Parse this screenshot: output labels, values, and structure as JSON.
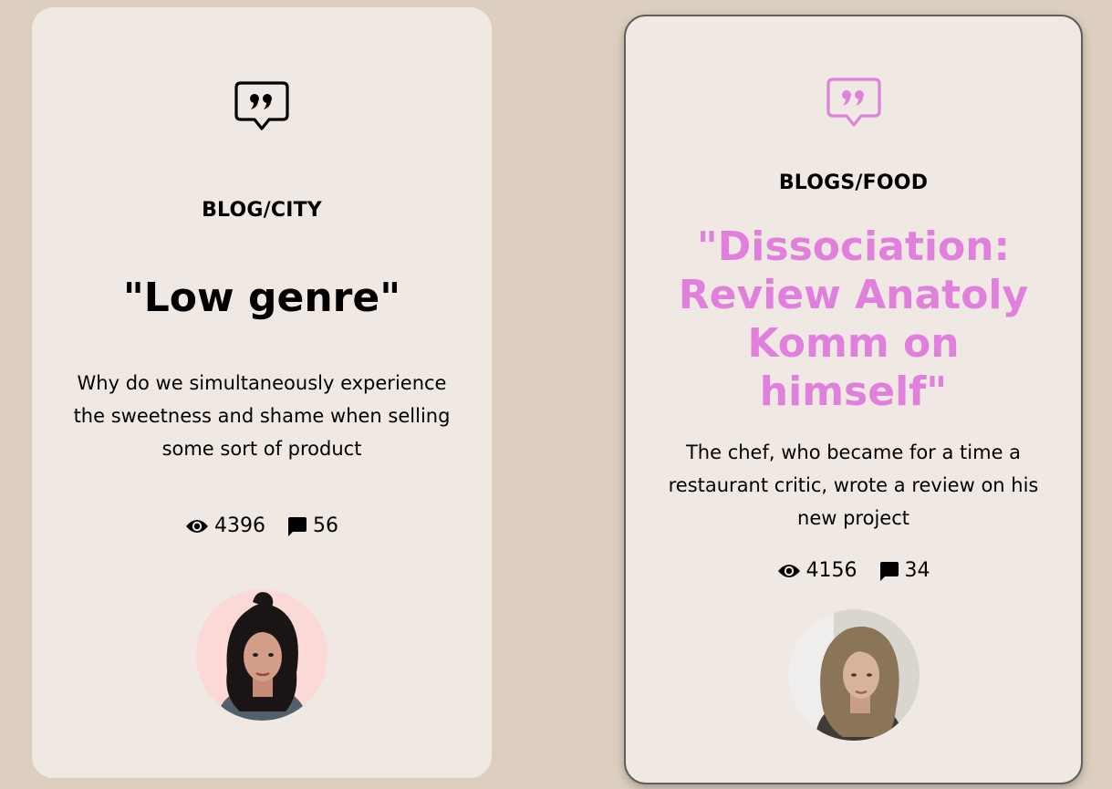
{
  "cards": [
    {
      "category": "BLOG/CITY",
      "title": "\"Low genre\"",
      "description": "Why do we simultaneously experience the sweetness and shame when selling some sort of product",
      "views": "4396",
      "comments": "56",
      "icon": "quote-bubble-icon",
      "accent_color": "#000000"
    },
    {
      "category": "BLOGS/FOOD",
      "title": "\"Dissociation: Review Anatoly Komm on himself\"",
      "description": "The chef, who became for a time a restaurant critic, wrote a review on his new project",
      "views": "4156",
      "comments": "34",
      "icon": "quote-bubble-icon",
      "accent_color": "#e080dc"
    }
  ],
  "colors": {
    "background": "#dccfbf",
    "card": "#f0e9e3"
  }
}
